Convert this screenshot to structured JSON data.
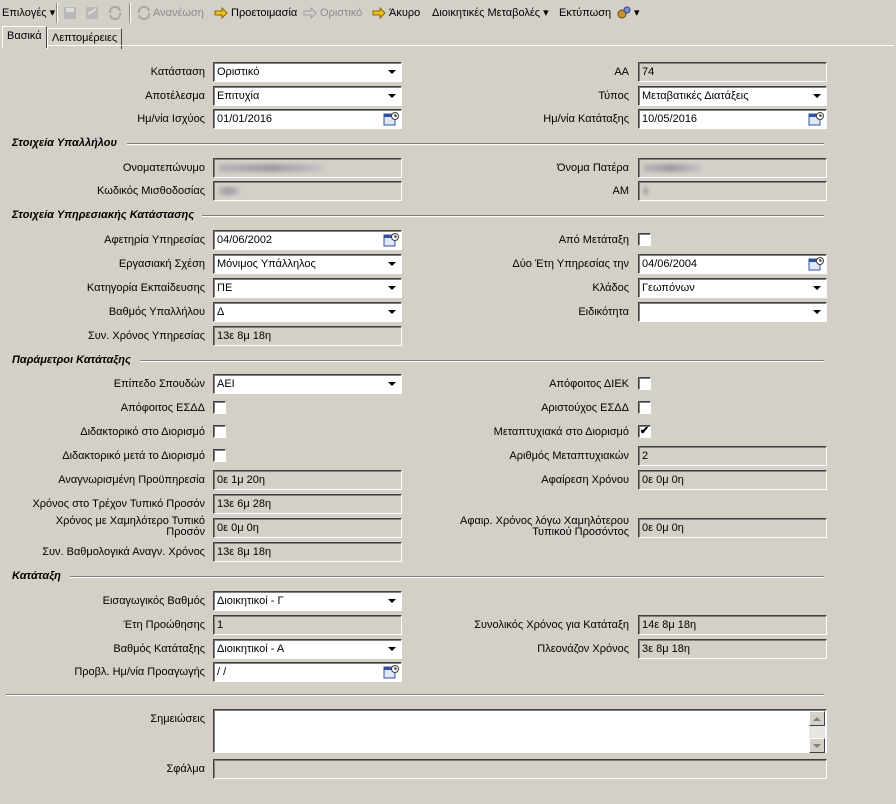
{
  "toolbar": {
    "options": "Επιλογές",
    "refresh": "Ανανέωση",
    "draft": "Προετοιμασία",
    "final": "Οριστικό",
    "cancel": "Άκυρο",
    "admin_changes": "Διοικητικές Μεταβολές",
    "print": "Εκτύπωση"
  },
  "tabs": [
    "Βασικά",
    "Λεπτομέρειες"
  ],
  "sections": {
    "employee": "Στοιχεία Υπαλλήλου",
    "service": "Στοιχεία Υπηρεσιακής Κατάστασης",
    "params": "Παράμετροι Κατάταξης",
    "classification": "Κατάταξη"
  },
  "labels": {
    "status": "Κατάσταση",
    "result": "Αποτέλεσμα",
    "valid_date": "Ημ/νία Ισχύος",
    "aa": "ΑΑ",
    "type": "Τύπος",
    "class_date": "Ημ/νία Κατάταξης",
    "fullname": "Ονοματεπώνυμο",
    "payroll_code": "Κωδικός Μισθοδοσίας",
    "father": "Όνομα Πατέρα",
    "am": "ΑΜ",
    "service_start": "Αφετηρία Υπηρεσίας",
    "work_relation": "Εργασιακή Σχέση",
    "edu_category": "Κατηγορία Εκπαίδευσης",
    "emp_grade": "Βαθμός Υπαλλήλου",
    "total_service": "Συν. Χρόνος Υπηρεσίας",
    "from_transfer": "Από Μετάταξη",
    "two_years": "Δύο Έτη Υπηρεσίας την",
    "branch": "Κλάδος",
    "specialty": "Ειδικότητα",
    "edu_level": "Επίπεδο Σπουδών",
    "esdd_grad": "Απόφοιτος ΕΣΔΔ",
    "phd_at": "Διδακτορικό στο Διορισμό",
    "phd_after": "Διδακτορικό μετά το Διορισμό",
    "prior_service": "Αναγνωρισμένη Προϋπηρεσία",
    "time_current": "Χρόνος στο Τρέχον Τυπικό Προσόν",
    "time_lower": "Χρόνος με Χαμηλότερο Τυπικό Προσόν",
    "total_grade_time": "Συν. Βαθμολογικά Αναγν. Χρόνος",
    "diek_grad": "Απόφοιτος ΔΙΕΚ",
    "esdd_top": "Αριστούχος ΕΣΔΔ",
    "msc_at": "Μεταπτυχιακά στο Διορισμό",
    "msc_count": "Αριθμός Μεταπτυχιακών",
    "time_removal": "Αφαίρεση Χρόνου",
    "time_removal_lower": "Αφαιρ. Χρόνος λόγω Χαμηλότερου Τυπικού Προσόντος",
    "entry_grade": "Εισαγωγικός Βαθμός",
    "promo_years": "Έτη Προώθησης",
    "class_grade": "Βαθμός Κατάταξης",
    "promo_date": "Προβλ. Ημ/νία Προαγωγής",
    "total_time_class": "Συνολικός Χρόνος για Κατάταξη",
    "excess_time": "Πλεονάζον Χρόνος",
    "notes": "Σημειώσεις",
    "error": "Σφάλμα"
  },
  "values": {
    "status": "Οριστικό",
    "result": "Επιτυχία",
    "valid_date": "01/01/2016",
    "aa": "74",
    "type": "Μεταβατικές Διατάξεις",
    "class_date": "10/05/2016",
    "service_start": "04/06/2002",
    "work_relation": "Μόνιμος Υπάλληλος",
    "edu_category": "ΠΕ",
    "emp_grade": "Δ",
    "total_service": "13ε  8μ 18η",
    "two_years": "04/06/2004",
    "branch": "Γεωπόνων",
    "specialty": "",
    "edu_level": "ΑΕΙ",
    "prior_service": " 0ε  1μ 20η",
    "time_current": "13ε  6μ 28η",
    "time_lower": " 0ε  0μ  0η",
    "total_grade_time": "13ε  8μ 18η",
    "msc_count": "2",
    "time_removal": " 0ε  0μ  0η",
    "time_removal_lower": " 0ε  0μ  0η",
    "entry_grade": "Διοικητικοί - Γ",
    "promo_years": "1",
    "class_grade": "Διοικητικοί - Α",
    "promo_date": " / /",
    "total_time_class": "14ε  8μ 18η",
    "excess_time": "3ε  8μ 18η",
    "notes": "",
    "error": ""
  },
  "checks": {
    "from_transfer": false,
    "esdd_grad": false,
    "phd_at": false,
    "phd_after": false,
    "diek_grad": false,
    "esdd_top": false,
    "msc_at": true
  },
  "colors": {
    "face": "#d4d0c8",
    "shadow": "#808080",
    "highlight": "#ffffff"
  }
}
